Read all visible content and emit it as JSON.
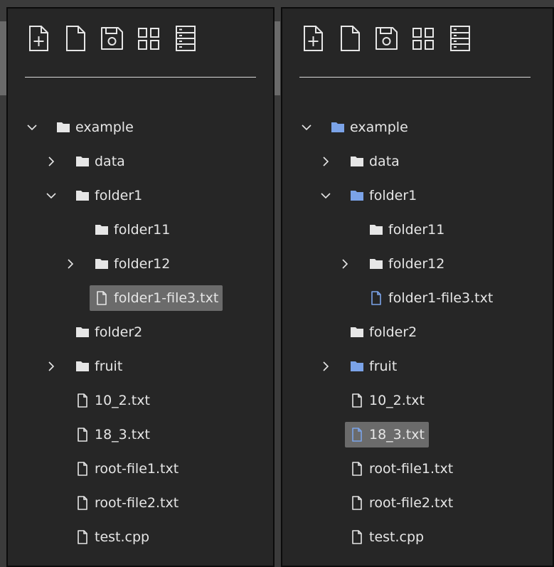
{
  "colors": {
    "folder": "#e6e6e6",
    "active_folder": "#7ba3e8",
    "file": "#e6e6e6",
    "active_file": "#7ba3e8",
    "selection": "#6b6b6b"
  },
  "toolbar": [
    {
      "icon": "new-file-icon"
    },
    {
      "icon": "file-icon"
    },
    {
      "icon": "save-icon"
    },
    {
      "icon": "grid-icon"
    },
    {
      "icon": "list-icon"
    }
  ],
  "panels": [
    {
      "name": "left",
      "rows": [
        {
          "depth": 0,
          "type": "folder",
          "label": "example",
          "chevron": "down"
        },
        {
          "depth": 1,
          "type": "folder",
          "label": "data",
          "chevron": "right"
        },
        {
          "depth": 1,
          "type": "folder",
          "label": "folder1",
          "chevron": "down"
        },
        {
          "depth": 2,
          "type": "folder",
          "label": "folder11",
          "chevron": ""
        },
        {
          "depth": 2,
          "type": "folder",
          "label": "folder12",
          "chevron": "right"
        },
        {
          "depth": 2,
          "type": "file",
          "label": "folder1-file3.txt",
          "chevron": "",
          "selected": true
        },
        {
          "depth": 1,
          "type": "folder",
          "label": "folder2",
          "chevron": ""
        },
        {
          "depth": 1,
          "type": "folder",
          "label": "fruit",
          "chevron": "right"
        },
        {
          "depth": 1,
          "type": "file",
          "label": "10_2.txt",
          "chevron": ""
        },
        {
          "depth": 1,
          "type": "file",
          "label": "18_3.txt",
          "chevron": ""
        },
        {
          "depth": 1,
          "type": "file",
          "label": "root-file1.txt",
          "chevron": ""
        },
        {
          "depth": 1,
          "type": "file",
          "label": "root-file2.txt",
          "chevron": ""
        },
        {
          "depth": 1,
          "type": "file",
          "label": "test.cpp",
          "chevron": ""
        }
      ]
    },
    {
      "name": "right",
      "rows": [
        {
          "depth": 0,
          "type": "folder",
          "label": "example",
          "chevron": "down",
          "highlight": true
        },
        {
          "depth": 1,
          "type": "folder",
          "label": "data",
          "chevron": "right"
        },
        {
          "depth": 1,
          "type": "folder",
          "label": "folder1",
          "chevron": "down",
          "highlight": true
        },
        {
          "depth": 2,
          "type": "folder",
          "label": "folder11",
          "chevron": ""
        },
        {
          "depth": 2,
          "type": "folder",
          "label": "folder12",
          "chevron": "right"
        },
        {
          "depth": 2,
          "type": "file",
          "label": "folder1-file3.txt",
          "chevron": "",
          "highlight": true
        },
        {
          "depth": 1,
          "type": "folder",
          "label": "folder2",
          "chevron": ""
        },
        {
          "depth": 1,
          "type": "folder",
          "label": "fruit",
          "chevron": "right",
          "highlight": true
        },
        {
          "depth": 1,
          "type": "file",
          "label": "10_2.txt",
          "chevron": ""
        },
        {
          "depth": 1,
          "type": "file",
          "label": "18_3.txt",
          "chevron": "",
          "selected": true,
          "highlight": true
        },
        {
          "depth": 1,
          "type": "file",
          "label": "root-file1.txt",
          "chevron": ""
        },
        {
          "depth": 1,
          "type": "file",
          "label": "root-file2.txt",
          "chevron": ""
        },
        {
          "depth": 1,
          "type": "file",
          "label": "test.cpp",
          "chevron": ""
        }
      ]
    }
  ]
}
